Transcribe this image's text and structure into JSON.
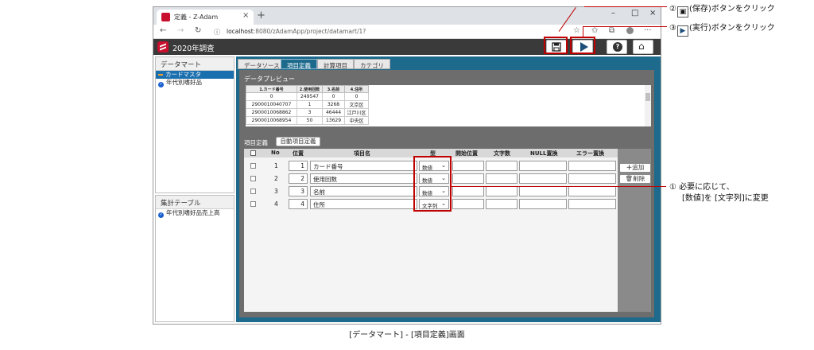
{
  "browser": {
    "tab_title": "定義 - Z-Adam",
    "tab_close": "×",
    "new_tab": "+",
    "url_host": "localhost",
    "url_rest": ":8080/zAdamApp/project/datamart/1?",
    "minimize": "–",
    "maximize": "□",
    "close": "×",
    "back": "←",
    "forward": "→",
    "reload": "↻",
    "info": "ⓘ",
    "star": "☆",
    "favorites": "✩",
    "collections": "⧉",
    "more": "···"
  },
  "app": {
    "title": "2020年調査",
    "help_glyph": "?",
    "home_glyph": "⌂"
  },
  "sidebar": {
    "datamart_header": "データマート",
    "datamart_items": [
      {
        "label": "カードマスタ",
        "selected": true
      },
      {
        "label": "年代別嗜好品",
        "selected": false
      }
    ],
    "aggregate_header": "集計テーブル",
    "aggregate_items": [
      {
        "label": "年代別嗜好品売上高"
      }
    ]
  },
  "tabs": [
    "データソース",
    "項目定義",
    "計算項目",
    "カテゴリ"
  ],
  "active_tab": "項目定義",
  "preview": {
    "title": "データプレビュー",
    "headers": [
      "1.カード番号",
      "2.使用回数",
      "3.名前",
      "4.住所"
    ],
    "rows": [
      [
        "0",
        "249547",
        "0",
        "0"
      ],
      [
        "2900010040707",
        "1",
        "3268",
        "文京区"
      ],
      [
        "2900010068862",
        "3",
        "46444",
        "江戸川区"
      ],
      [
        "2900010068954",
        "50",
        "13629",
        "中央区"
      ]
    ]
  },
  "definition": {
    "label": "項目定義",
    "auto_button": "自動項目定義",
    "headers": {
      "no": "No",
      "position": "位置",
      "name": "項目名",
      "type": "型",
      "start": "開始位置",
      "chars": "文字数",
      "null_replace": "NULL置換",
      "error_replace": "エラー置換"
    },
    "rows": [
      {
        "no": "1",
        "position": "1",
        "name": "カード番号",
        "type": "数値"
      },
      {
        "no": "2",
        "position": "2",
        "name": "使用回数",
        "type": "数値"
      },
      {
        "no": "3",
        "position": "3",
        "name": "名前",
        "type": "数値"
      },
      {
        "no": "4",
        "position": "4",
        "name": "住所",
        "type": "文字列"
      }
    ],
    "add_button": "追加",
    "delete_button": "削除"
  },
  "annotations": {
    "save_num": "②",
    "save_text": "(保存)ボタンをクリック",
    "run_num": "③",
    "run_text": "(実行)ボタンをクリック",
    "change_num": "①",
    "change_line1": "必要に応じて、",
    "change_line2": "[数値]を [文字列]に変更"
  },
  "caption": "[データマート] - [項目定義]画面",
  "colors": {
    "accent_blue": "#1d6a8c",
    "selection_blue": "#1a6fae",
    "brand_red": "#c8102e",
    "callout_red": "#c00000",
    "app_bar": "#3a3a3a"
  }
}
